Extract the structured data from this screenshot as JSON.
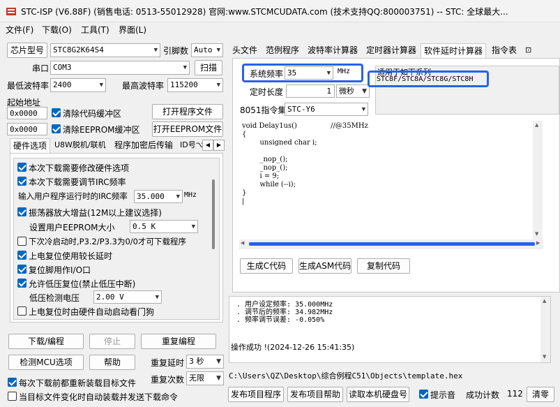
{
  "title": "STC-ISP (V6.88F) (销售电话: 0513-55012928) 官网:www.STCMCUDATA.com  (技术支持QQ:800003751) -- STC: 全球最大...",
  "menu": [
    "文件(F)",
    "下载(O)",
    "工具(T)",
    "界面(L)"
  ],
  "left": {
    "chip_label": "芯片型号",
    "chip_value": "STC8G2K64S4",
    "pins_label": "引脚数",
    "pins_value": "Auto",
    "port_label": "串口",
    "port_value": "COM3",
    "scan_btn": "扫描",
    "minbaud_label": "最低波特率",
    "minbaud_value": "2400",
    "maxbaud_label": "最高波特率",
    "maxbaud_value": "115200",
    "start_addr": "起始地址",
    "addr1": "0x0000",
    "clear_code": "清除代码缓冲区",
    "open_prog": "打开程序文件",
    "addr2": "0x0000",
    "clear_eeprom": "清除EEPROM缓冲区",
    "open_eeprom": "打开EEPROM文件",
    "tabs": [
      "硬件选项",
      "U8W脱机/联机",
      "程序加密后传输",
      "ID号⌥"
    ],
    "options": [
      {
        "text": "本次下载需要修改硬件选项",
        "checked": true
      },
      {
        "text": "本次下载需要调节IRC频率",
        "checked": true
      },
      {
        "text": "振荡器放大增益(12M以上建议选择)",
        "checked": true
      },
      {
        "text": "下次冷启动时,P3.2/P3.3为0/0才可下载程序",
        "checked": false
      },
      {
        "text": "上电复位使用较长延时",
        "checked": true
      },
      {
        "text": "复位脚用作I/O口",
        "checked": true
      },
      {
        "text": "允许低压复位(禁止低压中断)",
        "checked": true
      },
      {
        "text": "上电复位时由硬件自动启动看门狗",
        "checked": false
      }
    ],
    "irc_label": "输入用户程序运行时的IRC频率",
    "irc_value": "35.000",
    "irc_unit": "MHz",
    "eeprom_label": "设置用户EEPROM大小",
    "eeprom_value": "0.5 K",
    "lv_label": "低压检测电压",
    "lv_value": "2.00 V",
    "download_btn": "下载/编程",
    "stop_btn": "停止",
    "reprog_btn": "重复编程",
    "detect_btn": "检测MCU选项",
    "help_btn": "帮助",
    "delay_label": "重复延时",
    "delay_value": "3 秒",
    "reload_label": "每次下载前都重新装载目标文件",
    "repeat_label": "重复次数",
    "repeat_value": "无限",
    "auto_label": "当目标文件变化时自动装载并发送下载命令"
  },
  "right": {
    "tabs": [
      "头文件",
      "范例程序",
      "波特率计算器",
      "定时器计算器",
      "软件延时计算器",
      "指令表",
      "⊡"
    ],
    "freq_label": "系统频率",
    "freq_value": "35",
    "freq_unit": "MHz",
    "delay_label": "定时长度",
    "delay_value": "1",
    "delay_unit": "微秒",
    "isa_label": "8051指令集",
    "isa_value": "STC-Y6",
    "series_label": "适用于如下系列",
    "series_value": "STC8F/STC8A/STC8G/STC8H",
    "code": "void Delay1us()\t\t//@35MHz\n{\n\tunsigned char i;\n\n\t_nop_();\n\t_nop_();\n\ti = 9;\n\twhile (--i);\n}\n|",
    "gen_c": "生成C代码",
    "gen_asm": "生成ASM代码",
    "copy": "复制代码",
    "log_lines": [
      ". 用户设定频率: 35.000MHz",
      ". 调节后的频率: 34.982MHz",
      ". 频率调节误差: -0.050%"
    ],
    "log_status": "操作成功 !(2024-12-26 15:41:35)",
    "path": "C:\\Users\\QZ\\Desktop\\综合例程C51\\Objects\\template.hex",
    "publish_btn": "发布项目程序",
    "publish_help": "发布项目帮助",
    "read_disk": "读取本机硬盘号",
    "sound_label": "提示音",
    "success_label": "成功计数",
    "success_value": "112",
    "clear_btn": "清零"
  },
  "colors": {
    "accent": "#0067c0",
    "highlight": "#2563eb"
  }
}
